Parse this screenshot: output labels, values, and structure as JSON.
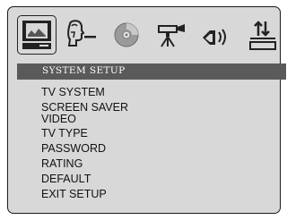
{
  "header": {
    "title": "SYSTEM SETUP"
  },
  "icons": [
    {
      "name": "system-setup-icon",
      "selected": true
    },
    {
      "name": "language-setup-icon",
      "selected": false
    },
    {
      "name": "audio-setup-icon",
      "selected": false
    },
    {
      "name": "video-setup-icon",
      "selected": false
    },
    {
      "name": "speaker-setup-icon",
      "selected": false
    },
    {
      "name": "digital-setup-icon",
      "selected": false
    }
  ],
  "menu": {
    "items": [
      "TV SYSTEM",
      "SCREEN SAVER",
      "VIDEO",
      "TV TYPE",
      "PASSWORD",
      "RATING",
      "DEFAULT",
      "EXIT SETUP"
    ]
  },
  "colors": {
    "panel": "#d8d8d8",
    "title_bar": "#5a5a5a",
    "title_text": "#ffffff",
    "text": "#111111"
  }
}
